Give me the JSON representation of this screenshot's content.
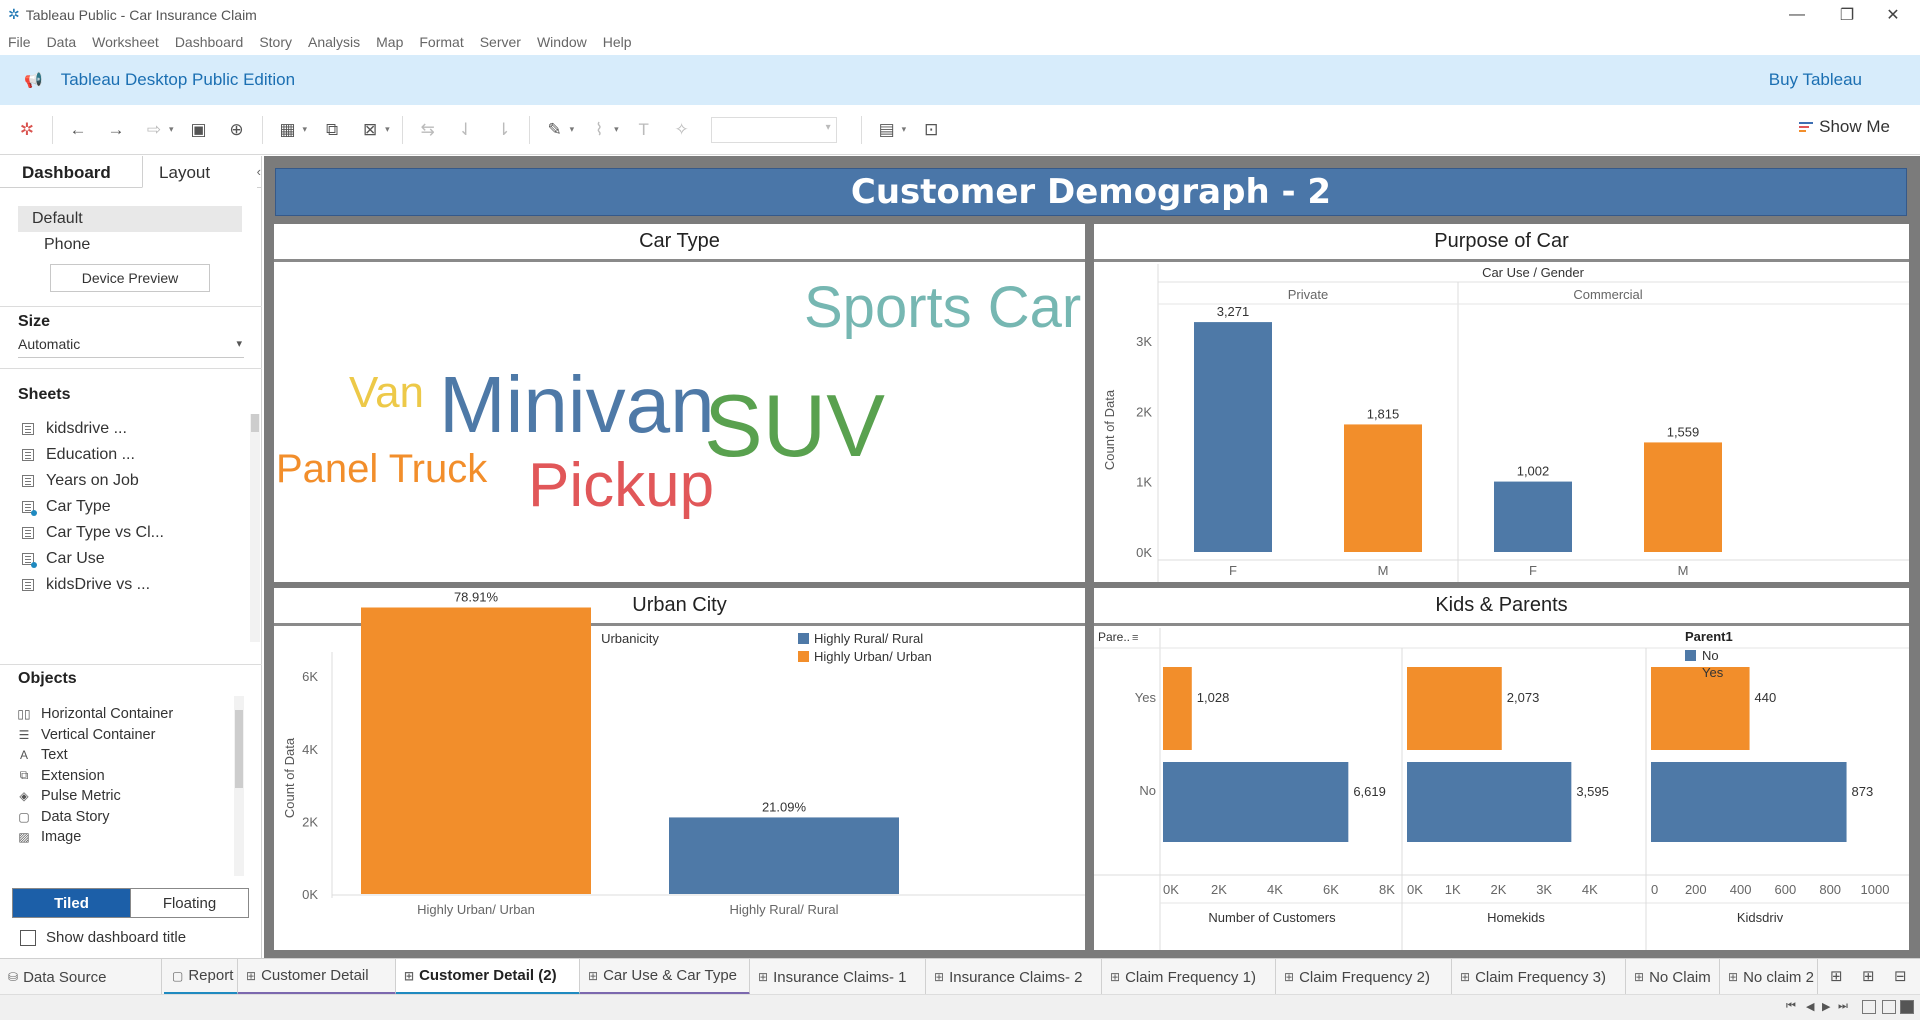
{
  "window": {
    "title": "Tableau Public - Car Insurance Claim",
    "controls": {
      "minimize": "—",
      "restore": "❐",
      "close": "✕"
    }
  },
  "menu": [
    "File",
    "Data",
    "Worksheet",
    "Dashboard",
    "Story",
    "Analysis",
    "Map",
    "Format",
    "Server",
    "Window",
    "Help"
  ],
  "banner": {
    "edition": "Tableau Desktop Public Edition",
    "buy": "Buy Tableau"
  },
  "toolbar": {
    "show_me": "Show Me"
  },
  "left_panel": {
    "tabs": {
      "dashboard": "Dashboard",
      "layout": "Layout"
    },
    "devices": {
      "default": "Default",
      "phone": "Phone",
      "preview_button": "Device Preview"
    },
    "size": {
      "heading": "Size",
      "value": "Automatic"
    },
    "sheets": {
      "heading": "Sheets",
      "items": [
        {
          "label": "kidsdrive ...",
          "marked": false
        },
        {
          "label": "Education ...",
          "marked": false
        },
        {
          "label": "Years on Job",
          "marked": false
        },
        {
          "label": "Car Type",
          "marked": true
        },
        {
          "label": "Car Type vs Cl...",
          "marked": false
        },
        {
          "label": "Car Use",
          "marked": true
        },
        {
          "label": "kidsDrive vs ...",
          "marked": false
        }
      ]
    },
    "objects": {
      "heading": "Objects",
      "items": [
        {
          "label": "Horizontal Container",
          "icon": "▯▯"
        },
        {
          "label": "Vertical Container",
          "icon": "☰"
        },
        {
          "label": "Text",
          "icon": "A"
        },
        {
          "label": "Extension",
          "icon": "⧉"
        },
        {
          "label": "Pulse Metric",
          "icon": "◈"
        },
        {
          "label": "Data Story",
          "icon": "▢"
        },
        {
          "label": "Image",
          "icon": "▨"
        }
      ]
    },
    "mode": {
      "tiled": "Tiled",
      "floating": "Floating"
    },
    "show_title": "Show dashboard title"
  },
  "dashboard": {
    "title": "Customer Demograph - 2",
    "panes": {
      "car_type": "Car Type",
      "purpose": "Purpose of Car",
      "urban": "Urban City",
      "kids": "Kids & Parents"
    }
  },
  "chart_data": [
    {
      "type": "word-cloud",
      "title": "Car Type",
      "words": [
        {
          "text": "Sports Car",
          "color": "#76b7b2"
        },
        {
          "text": "Van",
          "color": "#edc948"
        },
        {
          "text": "Minivan",
          "color": "#4e79a7"
        },
        {
          "text": "SUV",
          "color": "#59a14f"
        },
        {
          "text": "Panel Truck",
          "color": "#f28e2b"
        },
        {
          "text": "Pickup",
          "color": "#e15759"
        }
      ]
    },
    {
      "type": "bar",
      "title": "Purpose of Car",
      "header": "Car Use  /  Gender",
      "ylabel": "Count of Data",
      "ylim": [
        0,
        3500
      ],
      "yticks": [
        {
          "v": 0,
          "label": "0K"
        },
        {
          "v": 1000,
          "label": "1K"
        },
        {
          "v": 2000,
          "label": "2K"
        },
        {
          "v": 3000,
          "label": "3K"
        }
      ],
      "groups": [
        {
          "name": "Private",
          "bars": [
            {
              "category": "F",
              "value": 3271,
              "label": "3,271",
              "color": "#4e79a7"
            },
            {
              "category": "M",
              "value": 1815,
              "label": "1,815",
              "color": "#f28e2b"
            }
          ]
        },
        {
          "name": "Commercial",
          "bars": [
            {
              "category": "F",
              "value": 1002,
              "label": "1,002",
              "color": "#4e79a7"
            },
            {
              "category": "M",
              "value": 1559,
              "label": "1,559",
              "color": "#f28e2b"
            }
          ]
        }
      ]
    },
    {
      "type": "bar",
      "title": "Urban City",
      "header": "Urbanicity",
      "ylabel": "Count of Data",
      "ylim": [
        0,
        6500
      ],
      "yticks": [
        {
          "v": 0,
          "label": "0K"
        },
        {
          "v": 2000,
          "label": "2K"
        },
        {
          "v": 4000,
          "label": "4K"
        },
        {
          "v": 6000,
          "label": "6K"
        }
      ],
      "categories": [
        "Highly Urban/ Urban",
        "Highly Rural/ Rural"
      ],
      "values": [
        7891,
        2109
      ],
      "labels": [
        "78.91%",
        "21.09%"
      ],
      "colors": [
        "#f28e2b",
        "#4e79a7"
      ],
      "legend": [
        {
          "label": "Highly Rural/ Rural",
          "color": "#4e79a7"
        },
        {
          "label": "Highly Urban/ Urban",
          "color": "#f28e2b"
        }
      ],
      "legend_position": "top-right"
    },
    {
      "type": "bar",
      "orientation": "horizontal",
      "title": "Kids & Parents",
      "row_header": "Pare..",
      "rows": [
        "Yes",
        "No"
      ],
      "legend": {
        "title": "Parent1",
        "items": [
          {
            "label": "No",
            "color": "#4e79a7"
          },
          {
            "label": "Yes",
            "color": "#f28e2b"
          }
        ]
      },
      "panels": [
        {
          "xlabel": "Number of Customers",
          "xlim": [
            0,
            8000
          ],
          "ticks": [
            {
              "v": 0,
              "label": "0K"
            },
            {
              "v": 2000,
              "label": "2K"
            },
            {
              "v": 4000,
              "label": "4K"
            },
            {
              "v": 6000,
              "label": "6K"
            },
            {
              "v": 8000,
              "label": "8K"
            }
          ],
          "yes": 1028,
          "yes_label": "1,028",
          "no": 6619,
          "no_label": "6,619"
        },
        {
          "xlabel": "Homekids",
          "xlim": [
            0,
            4900
          ],
          "ticks": [
            {
              "v": 0,
              "label": "0K"
            },
            {
              "v": 1000,
              "label": "1K"
            },
            {
              "v": 2000,
              "label": "2K"
            },
            {
              "v": 3000,
              "label": "3K"
            },
            {
              "v": 4000,
              "label": "4K"
            }
          ],
          "yes": 2073,
          "yes_label": "2,073",
          "no": 3595,
          "no_label": "3,595"
        },
        {
          "xlabel": "Kidsdriv",
          "xlim": [
            0,
            1000
          ],
          "ticks": [
            {
              "v": 0,
              "label": "0"
            },
            {
              "v": 200,
              "label": "200"
            },
            {
              "v": 400,
              "label": "400"
            },
            {
              "v": 600,
              "label": "600"
            },
            {
              "v": 800,
              "label": "800"
            },
            {
              "v": 1000,
              "label": "1000"
            }
          ],
          "yes": 440,
          "yes_label": "440",
          "no": 873,
          "no_label": "873"
        }
      ]
    }
  ],
  "sheet_tabs": {
    "data_source": "Data Source",
    "tabs": [
      "Report",
      "Customer Detail",
      "Customer Detail (2)",
      "Car Use & Car Type",
      "Insurance Claims- 1",
      "Insurance Claims- 2",
      "Claim Frequency 1)",
      "Claim Frequency 2)",
      "Claim Frequency 3)",
      "No Claim",
      "No claim 2"
    ],
    "active": "Customer Detail (2)"
  }
}
